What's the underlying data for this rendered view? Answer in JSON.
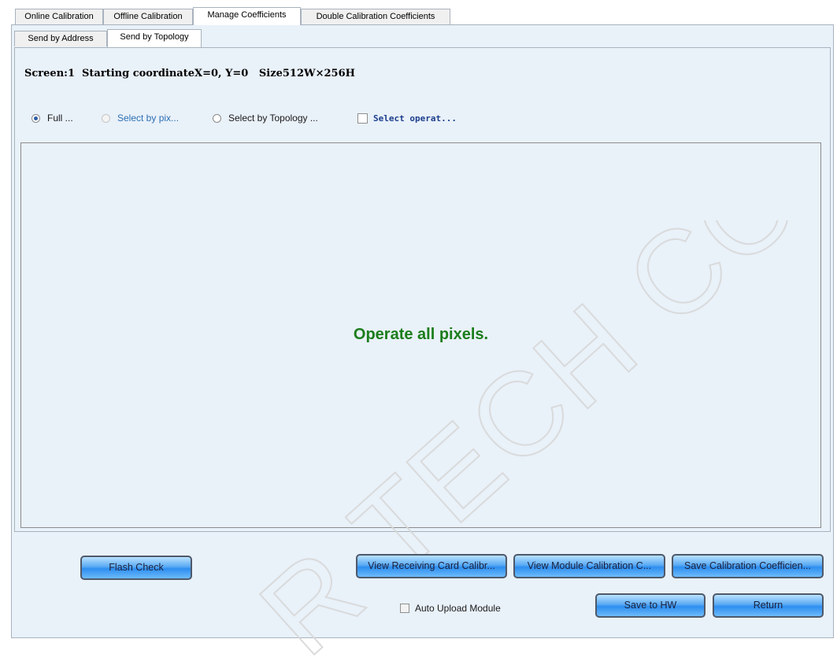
{
  "top_tabs": {
    "online": "Online Calibration",
    "offline": "Offline Calibration",
    "manage": "Manage Coefficients",
    "double": "Double Calibration Coefficients"
  },
  "sub_tabs": {
    "by_address": "Send by Address",
    "by_topology": "Send by Topology"
  },
  "screen_info": "Screen:1  Starting coordinateX=0, Y=0   Size512W×256H",
  "options": {
    "full": "Full ...",
    "select_pixel": "Select by pix...",
    "select_topology": "Select by Topology ...",
    "select_operat": "Select operat..."
  },
  "canvas_message": "Operate all pixels.",
  "buttons": {
    "flash_check": "Flash Check",
    "view_receiving": "View Receiving Card Calibr...",
    "view_module": "View Module Calibration C...",
    "save_coeff": "Save Calibration Coefficien...",
    "save_hw": "Save to HW",
    "return": "Return"
  },
  "auto_upload": "Auto Upload Module",
  "watermark": "R TECH CO.,LTD.",
  "colors": {
    "panel": "#e9f1f9",
    "message": "#1b7d1b",
    "button_blue": "#2d8ef0"
  }
}
